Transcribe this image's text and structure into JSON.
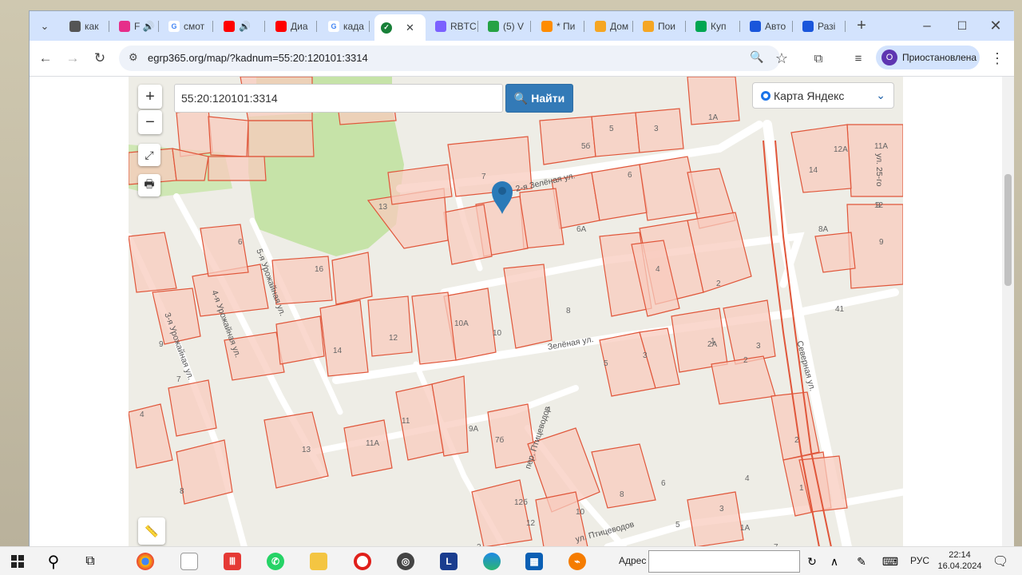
{
  "browser": {
    "tabs": [
      {
        "label": "как",
        "color": "#555"
      },
      {
        "label": "F 🔊",
        "color": "#e62e8a"
      },
      {
        "label": "смот",
        "color": "#4285f4",
        "g": true
      },
      {
        "label": "🔊",
        "color": "#ff0000"
      },
      {
        "label": "Диа",
        "color": "#ff0000"
      },
      {
        "label": "када",
        "color": "#4285f4",
        "g": true
      },
      {
        "label": "",
        "color": "#188038",
        "active": true
      },
      {
        "label": "RBTC",
        "color": "#7b61ff"
      },
      {
        "label": "(5) V",
        "color": "#25a244"
      },
      {
        "label": "* Пи",
        "color": "#ff8c00"
      },
      {
        "label": "Дом",
        "color": "#f5a623"
      },
      {
        "label": "Пои",
        "color": "#f5a623"
      },
      {
        "label": "Куп",
        "color": "#00a651"
      },
      {
        "label": "Авто",
        "color": "#1a56db"
      },
      {
        "label": "Разі",
        "color": "#1a56db"
      }
    ],
    "url": "egrp365.org/map/?kadnum=55:20:120101:3314",
    "profile_letter": "О",
    "profile_label": "Приостановлена"
  },
  "map": {
    "search_value": "55:20:120101:3314",
    "find_label": "Найти",
    "layer_label": "Карта Яндекс",
    "zoom_in": "+",
    "zoom_out": "−",
    "parcel_numbers": [
      "5",
      "3",
      "1A",
      "5б",
      "7",
      "6",
      "13",
      "6A",
      "4",
      "2",
      "16",
      "8",
      "10A",
      "10",
      "12",
      "14",
      "6",
      "9",
      "9",
      "7",
      "1",
      "3",
      "2",
      "5",
      "3",
      "4",
      "11",
      "11A",
      "9A",
      "7б",
      "1",
      "13",
      "8",
      "12б",
      "12",
      "8",
      "10",
      "6",
      "5",
      "3",
      "4",
      "2",
      "2A",
      "1",
      "1A",
      "7",
      "2",
      "14",
      "12A",
      "11A",
      "12",
      "9",
      "8A",
      "41",
      "66"
    ],
    "streets": [
      "2-я Зелёная ул.",
      "5-я Урожайная ул.",
      "4-я Урожайная ул.",
      "3-я Урожайная ул.",
      "Зелёная ул.",
      "пер. Птицеводов",
      "ул. Птицеводов",
      "Северная ул.",
      "ул. 25-го"
    ]
  },
  "taskbar": {
    "addr_label": "Адрес",
    "lang": "РУС",
    "time": "22:14",
    "date": "16.04.2024"
  }
}
